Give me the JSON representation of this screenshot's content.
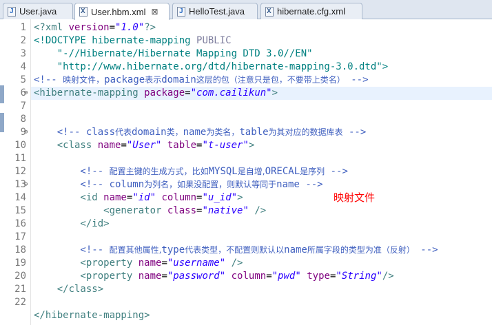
{
  "tabs": [
    {
      "label": "User.java",
      "icon": "java-file-icon"
    },
    {
      "label": "User.hbm.xml",
      "icon": "xml-file-icon",
      "active": true,
      "close": "⊠"
    },
    {
      "label": "HelloTest.java",
      "icon": "java-file-icon"
    },
    {
      "label": "hibernate.cfg.xml",
      "icon": "xml-file-icon"
    }
  ],
  "line_numbers": [
    "1",
    "2",
    "3",
    "4",
    "5",
    "6",
    "7",
    "8",
    "9",
    "10",
    "11",
    "12",
    "13",
    "14",
    "15",
    "16",
    "17",
    "18",
    "19",
    "20",
    "21",
    "22"
  ],
  "code": {
    "l1": {
      "pi_open": "<?xml ",
      "attr": "version",
      "eq": "=",
      "val": "\"1.0\"",
      "pi_close": "?>"
    },
    "l2": {
      "text": "<!DOCTYPE hibernate-mapping ",
      "kw": "PUBLIC"
    },
    "l3": {
      "text": "    \"-//Hibernate/Hibernate Mapping DTD 3.0//EN\""
    },
    "l4": {
      "text": "    \"http://www.hibernate.org/dtd/hibernate-mapping-3.0.dtd\">"
    },
    "l5": {
      "open": "<!-- ",
      "cjk1": "映射文件，",
      "mid": "package",
      "cjk2": "表示",
      "mid2": "domain",
      "cjk3": "这层的包（注意只是包，不要带上类名）",
      "close": " -->"
    },
    "l6": {
      "tag": "<hibernate-mapping ",
      "attr": "package",
      "eq": "=",
      "val": "\"com.cailikun\"",
      "end": ">"
    },
    "l8": {
      "open": "    <!-- class",
      "cjk1": "代表",
      "mid": "domain",
      "cjk2": "类，",
      "mid2": "name",
      "cjk3": "为类名，",
      "mid3": "table",
      "cjk4": "为其对应的数据库表",
      "close": " -->"
    },
    "l9": {
      "tag": "    <class ",
      "attr1": "name",
      "val1": "\"User\"",
      "attr2": " table",
      "val2": "\"t-user\"",
      "end": ">"
    },
    "l11": {
      "open": "        <!-- ",
      "cjk1": "配置主键的生成方式，比如",
      "mid": "MYSQL",
      "cjk2": "是自增,",
      "mid2": "ORECAL",
      "cjk3": "是序列",
      "close": " -->"
    },
    "l12": {
      "open": "        <!-- column",
      "cjk1": "为列名，如果没配置，则默认等同于",
      "mid": "name",
      "close": " -->"
    },
    "l13": {
      "tag": "        <id ",
      "attr1": "name",
      "val1": "\"id\"",
      "attr2": " column",
      "val2": "\"u_id\"",
      "end": ">"
    },
    "l14": {
      "tag": "            <generator ",
      "attr": "class",
      "val": "\"native\"",
      "end": " />"
    },
    "l15": {
      "text": "        </id>"
    },
    "l17": {
      "open": "        <!-- ",
      "cjk1": "配置其他属性,",
      "mid": "type",
      "cjk2": "代表类型，不配置则默认以",
      "mid2": "name",
      "cjk3": "所属字段的类型为准（反射）",
      "close": " -->"
    },
    "l18": {
      "tag": "        <property ",
      "attr": "name",
      "val": "\"username\"",
      "end": " />"
    },
    "l19": {
      "tag": "        <property ",
      "attr1": "name",
      "val1": "\"password\"",
      "attr2": " column",
      "val2": "\"pwd\"",
      "attr3": " type",
      "val3": "\"String\"",
      "end": "/>"
    },
    "l20": {
      "text": "    </class>"
    },
    "l22": {
      "text": "</hibernate-mapping>"
    }
  },
  "annotation": "映射文件",
  "colors": {
    "tag": "#3f7f7f",
    "attribute": "#7f007f",
    "value": "#2a00ff",
    "comment": "#3f5fbf",
    "annotation": "#ff0000"
  }
}
